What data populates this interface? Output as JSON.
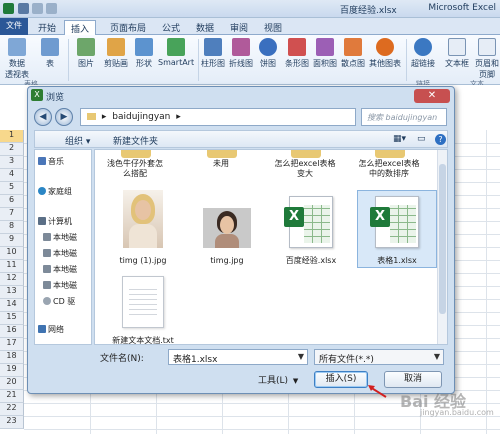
{
  "app": {
    "doc_title": "百度经验.xlsx",
    "app_title": "Microsoft Excel"
  },
  "ribbon_tabs": [
    "开始",
    "插入",
    "页面布局",
    "公式",
    "数据",
    "审阅",
    "视图"
  ],
  "ribbon_tab_active": "插入",
  "file_tab": "文件",
  "ribbon": {
    "pivot_label": "数据\n透视表",
    "table_label": "表",
    "picture_label": "图片",
    "clipart_label": "剪贴画",
    "shapes_label": "形状",
    "smartart_label": "SmartArt",
    "column_label": "柱形图",
    "line_label": "折线图",
    "pie_label": "饼图",
    "bar_label": "条形图",
    "area_label": "面积图",
    "scatter_label": "散点图",
    "other_label": "其他图表",
    "hyperlink_label": "超链接",
    "textbox_label": "文本框",
    "header_label": "页眉和\n页脚",
    "group_tables": "表格",
    "group_links": "链接",
    "group_text": "文本"
  },
  "rows": [
    "1",
    "2",
    "3",
    "4",
    "5",
    "6",
    "7",
    "8",
    "9",
    "10",
    "11",
    "12",
    "13",
    "14",
    "15",
    "16",
    "17",
    "18",
    "19",
    "20",
    "21",
    "22",
    "23"
  ],
  "dialog": {
    "title": "浏览",
    "close": "✕",
    "path_sep": "▸",
    "path": "baidujingyan",
    "search_placeholder": "搜索 baidujingyan",
    "organize": "组织 ▾",
    "new_folder": "新建文件夹",
    "nav_items": [
      {
        "label": "音乐",
        "color": "#4a76b8"
      },
      {
        "label": "家庭组",
        "color": "#2b86c5"
      },
      {
        "label": "计算机",
        "color": "#5b6f86"
      },
      {
        "label": "本地磁",
        "color": "#7d8a99"
      },
      {
        "label": "本地磁",
        "color": "#7d8a99"
      },
      {
        "label": "本地磁",
        "color": "#7d8a99"
      },
      {
        "label": "本地磁",
        "color": "#7d8a99"
      },
      {
        "label": "CD 驱",
        "color": "#9aa5b1"
      },
      {
        "label": "网络",
        "color": "#3f73b1"
      }
    ],
    "files": {
      "top_folder_1": "浅色牛仔外套怎\n么搭配",
      "top_folder_2": "未用",
      "top_folder_3": "怎么把excel表格\n变大",
      "top_folder_4": "怎么把excel表格\n中的数排序",
      "file_1": "timg (1).jpg",
      "file_2": "timg.jpg",
      "file_3": "百度经验.xlsx",
      "file_4": "表格1.xlsx",
      "file_5": "新建文本文档.txt"
    },
    "filename_label": "文件名(N):",
    "filename_value": "表格1.xlsx",
    "filetype_value": "所有文件(*.*)",
    "tools_label": "工具(L)",
    "insert_label": "插入(S)",
    "cancel_label": "取消"
  },
  "watermark": {
    "main": "Bai 经验",
    "sub": "jingyan.baidu.com"
  }
}
